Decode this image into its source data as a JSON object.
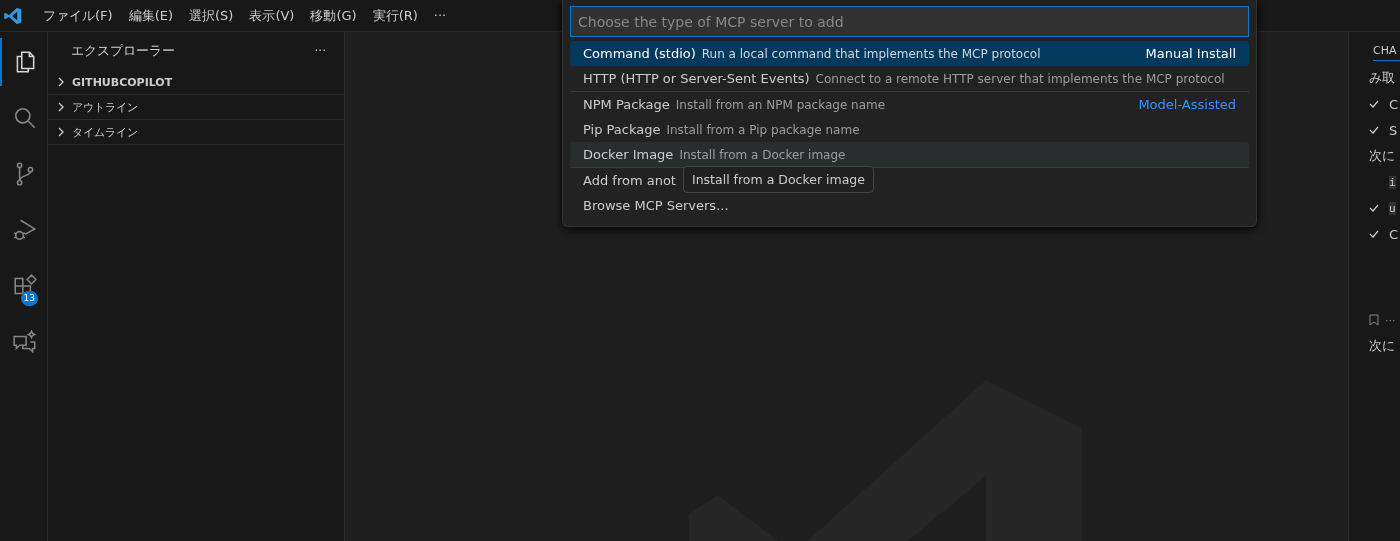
{
  "menu_bar": {
    "items": [
      "ファイル(F)",
      "編集(E)",
      "選択(S)",
      "表示(V)",
      "移動(G)",
      "実行(R)",
      "···"
    ]
  },
  "activity_bar": {
    "items": [
      {
        "kind": "files",
        "selected": true
      },
      {
        "kind": "search",
        "selected": false
      },
      {
        "kind": "source-control",
        "selected": false
      },
      {
        "kind": "run-debug",
        "selected": false
      },
      {
        "kind": "extensions",
        "selected": false,
        "badge": "13"
      },
      {
        "kind": "chat",
        "selected": false
      }
    ]
  },
  "sidebar": {
    "title": "エクスプローラー",
    "more": "···",
    "sections": [
      {
        "label": "GITHUBCOPILOT",
        "expanded": false,
        "bold": true
      },
      {
        "label": "アウトライン",
        "expanded": false,
        "bold": false
      },
      {
        "label": "タイムライン",
        "expanded": false,
        "bold": false
      }
    ]
  },
  "quick_pick": {
    "placeholder": "Choose the type of MCP server to add",
    "items": [
      {
        "label": "Command (stdio)",
        "description": "Run a local command that implements the MCP protocol",
        "group_label": "Manual Install",
        "separator_before": false,
        "selected": true,
        "hovered": false
      },
      {
        "label": "HTTP (HTTP or Server-Sent Events)",
        "description": "Connect to a remote HTTP server that implements the MCP protocol",
        "separator_before": false,
        "selected": false,
        "hovered": false
      },
      {
        "label": "NPM Package",
        "description": "Install from an NPM package name",
        "group_label": "Model-Assisted",
        "separator_before": true,
        "selected": false,
        "hovered": false
      },
      {
        "label": "Pip Package",
        "description": "Install from a Pip package name",
        "separator_before": false,
        "selected": false,
        "hovered": false
      },
      {
        "label": "Docker Image",
        "description": "Install from a Docker image",
        "separator_before": false,
        "selected": false,
        "hovered": true
      },
      {
        "label": "Add from anot",
        "separator_before": true,
        "selected": false,
        "hovered": false
      },
      {
        "label": "Browse MCP Servers...",
        "separator_before": false,
        "selected": false,
        "hovered": false
      }
    ],
    "tooltip": "Install from a Docker image"
  },
  "chat_panel": {
    "tab": "CHA",
    "lines": [
      {
        "kind": "text",
        "text": "み取"
      },
      {
        "kind": "check",
        "text": "C"
      },
      {
        "kind": "check",
        "text": "S"
      },
      {
        "kind": "text",
        "text": "次に"
      },
      {
        "kind": "code",
        "text": "i"
      },
      {
        "kind": "check-code",
        "text": "u"
      },
      {
        "kind": "check",
        "text": "C"
      },
      {
        "kind": "bookmark",
        "text": "···"
      },
      {
        "kind": "text",
        "text": "次に"
      }
    ]
  }
}
